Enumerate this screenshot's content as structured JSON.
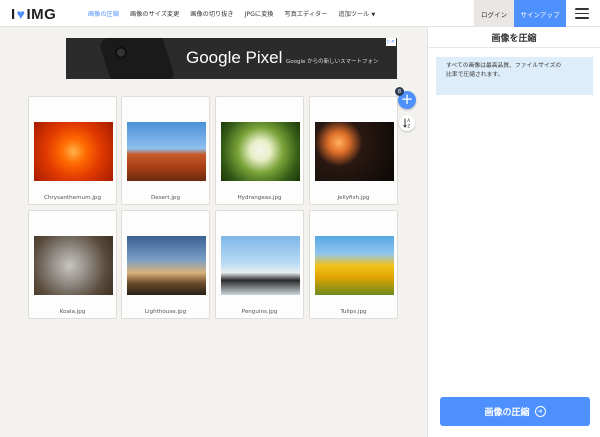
{
  "header": {
    "logo_prefix": "I",
    "logo_suffix": "IMG",
    "nav": [
      {
        "label": "画像の圧縮"
      },
      {
        "label": "画像のサイズ変更"
      },
      {
        "label": "画像の切り抜き"
      },
      {
        "label": "JPGに変換"
      },
      {
        "label": "写真エディター"
      },
      {
        "label": "追加ツール"
      }
    ],
    "login_label": "ログイン",
    "signup_label": "サインアップ",
    "accent_color": "#4d90fe"
  },
  "ad": {
    "title": "Google Pixel",
    "subtitle": "Google からの新しいスマートフォン"
  },
  "files": {
    "count": "8",
    "items": [
      {
        "name": "Chrysanthemum.jpg"
      },
      {
        "name": "Desert.jpg"
      },
      {
        "name": "Hydrangeas.jpg"
      },
      {
        "name": "Jellyfish.jpg"
      },
      {
        "name": "Koala.jpg"
      },
      {
        "name": "Lighthouse.jpg"
      },
      {
        "name": "Penguins.jpg"
      },
      {
        "name": "Tulips.jpg"
      }
    ]
  },
  "sidebar": {
    "title": "画像を圧縮",
    "info_line1": "すべての画像は最高品質、ファイルサイズの",
    "info_line2": "比率で圧縮されます。",
    "compress_label": "画像の圧縮"
  }
}
